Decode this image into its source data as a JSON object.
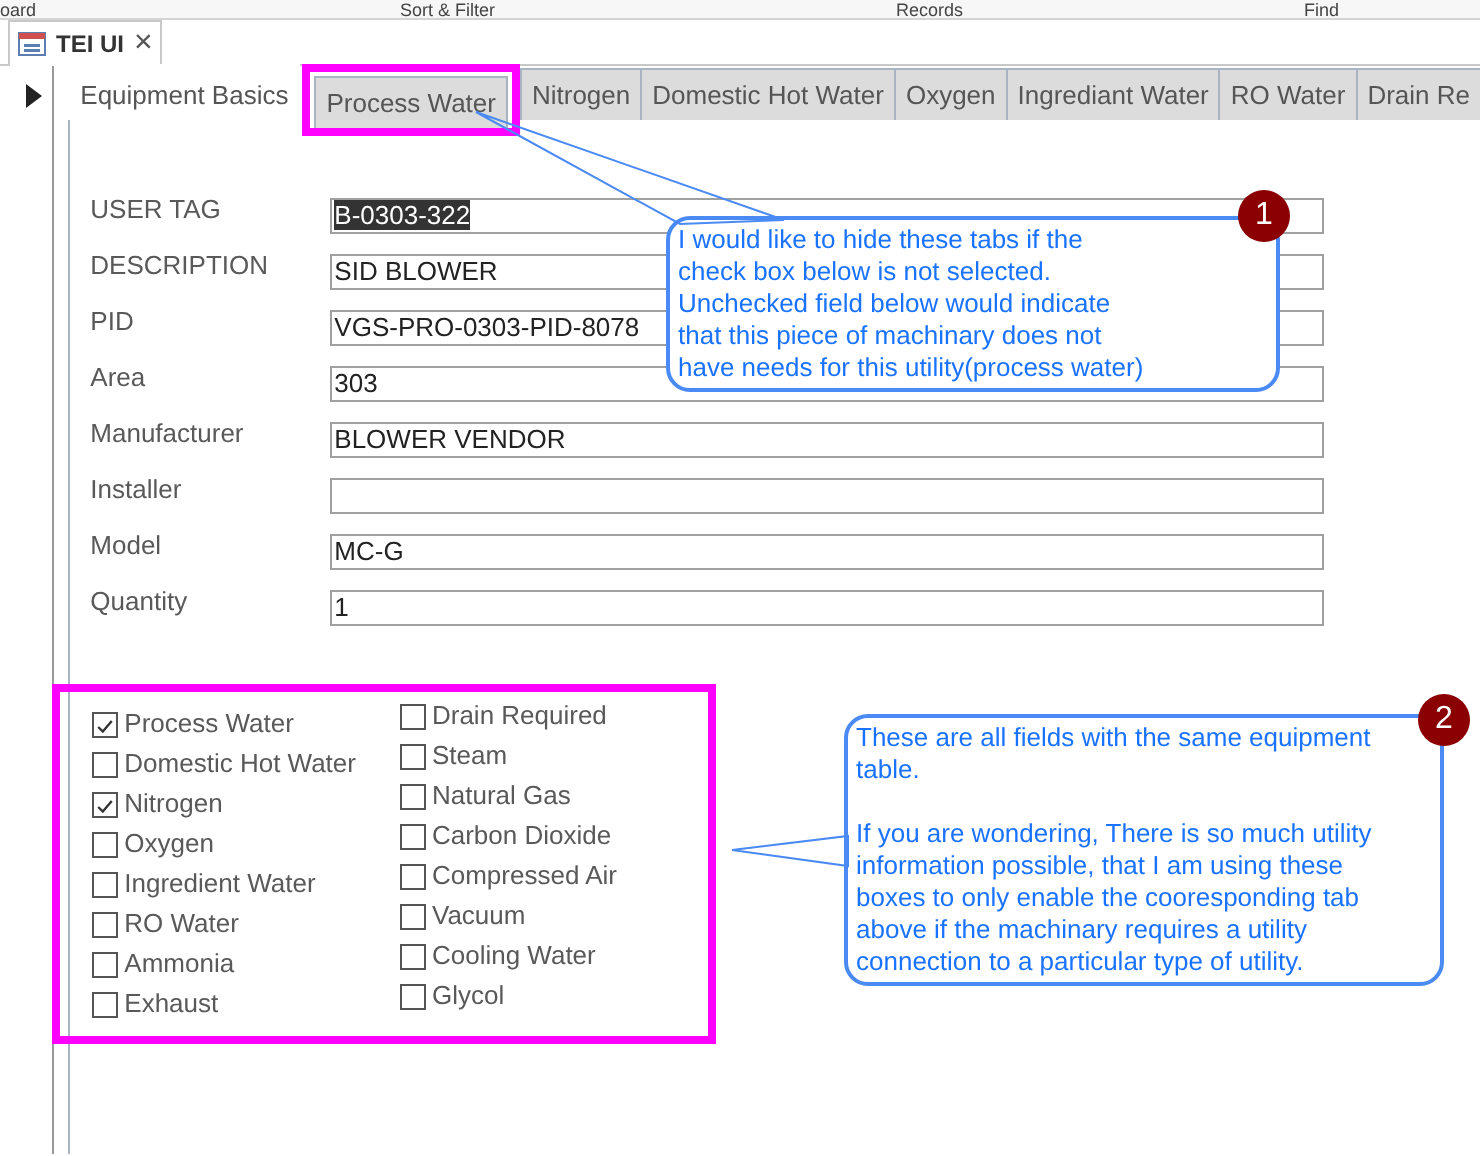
{
  "ribbon_groups": [
    "oard",
    "Sort & Filter",
    "Records",
    "Find"
  ],
  "document_tab": {
    "title": "TEI UI",
    "close": "×"
  },
  "tabs": [
    {
      "label": "Equipment Basics",
      "selected": true,
      "highlighted": false
    },
    {
      "label": "Process Water",
      "selected": false,
      "highlighted": true
    },
    {
      "label": "Nitrogen",
      "selected": false,
      "highlighted": false
    },
    {
      "label": "Domestic Hot Water",
      "selected": false,
      "highlighted": false
    },
    {
      "label": "Oxygen",
      "selected": false,
      "highlighted": false
    },
    {
      "label": "Ingrediant Water",
      "selected": false,
      "highlighted": false
    },
    {
      "label": "RO Water",
      "selected": false,
      "highlighted": false
    },
    {
      "label": "Drain Re",
      "selected": false,
      "highlighted": false
    }
  ],
  "fields": [
    {
      "label": "USER TAG",
      "value": "B-0303-322",
      "text_selected": true
    },
    {
      "label": "DESCRIPTION",
      "value": "SID BLOWER"
    },
    {
      "label": "PID",
      "value": "VGS-PRO-0303-PID-8078"
    },
    {
      "label": "Area",
      "value": "303"
    },
    {
      "label": "Manufacturer",
      "value": "BLOWER VENDOR"
    },
    {
      "label": "Installer"
    },
    {
      "label": "Model",
      "value": "MC-G"
    },
    {
      "label": "Quantity",
      "value": "1"
    }
  ],
  "utility_checkboxes": [
    [
      {
        "label": "Process Water",
        "checked": true
      },
      {
        "label": "Domestic Hot Water",
        "checked": false
      },
      {
        "label": "Nitrogen",
        "checked": true
      },
      {
        "label": "Oxygen",
        "checked": false
      },
      {
        "label": "Ingredient Water",
        "checked": false
      },
      {
        "label": "RO Water",
        "checked": false
      },
      {
        "label": "Ammonia",
        "checked": false
      },
      {
        "label": "Exhaust",
        "checked": false
      }
    ],
    [
      {
        "label": "Drain Required",
        "checked": false
      },
      {
        "label": "Steam",
        "checked": false
      },
      {
        "label": "Natural Gas",
        "checked": false
      },
      {
        "label": "Carbon Dioxide",
        "checked": false
      },
      {
        "label": "Compressed Air",
        "checked": false
      },
      {
        "label": "Vacuum",
        "checked": false
      },
      {
        "label": "Cooling Water",
        "checked": false
      },
      {
        "label": "Glycol",
        "checked": false
      }
    ]
  ],
  "callouts": [
    {
      "number": "1",
      "paragraphs": [
        "I would like to hide these tabs if the\ncheck box below is not selected.\nUnchecked field below would indicate\nthat this piece of machinary does not\nhave needs for this utility(process water)"
      ]
    },
    {
      "number": "2",
      "paragraphs": [
        "These are all fields with the same equipment\ntable.",
        "If you are wondering, There is so much utility\ninformation possible, that I am using these\nboxes to only enable the cooresponding tab\nabove if the machinary requires a utility\nconnection to a particular type of utility."
      ]
    }
  ]
}
